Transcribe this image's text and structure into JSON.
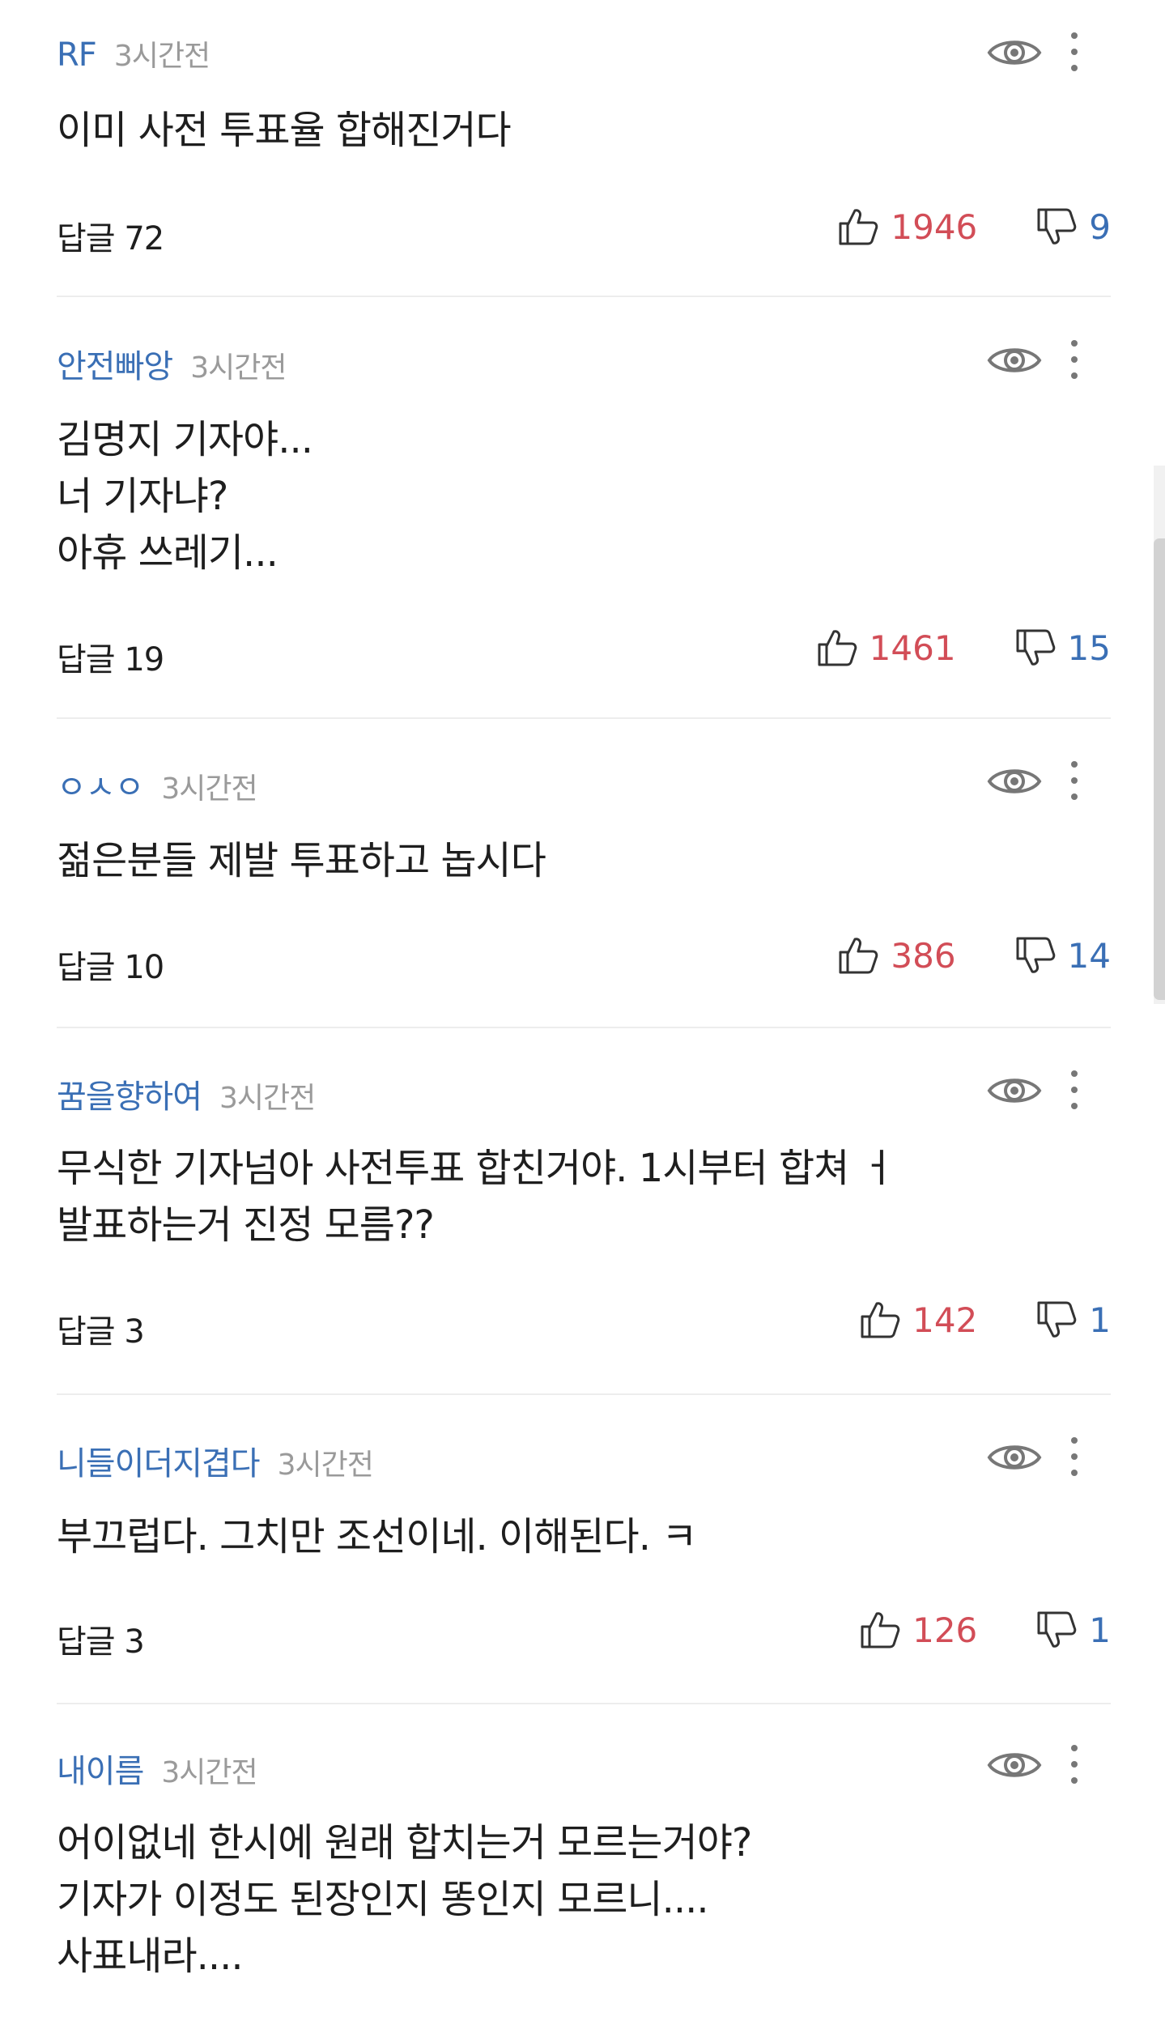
{
  "comments": [
    {
      "author": "RF",
      "time": "3시간전",
      "lines": [
        "이미 사전 투표율 합해진거다"
      ],
      "reply": "답글 72",
      "likes": "1946",
      "dislikes": "9"
    },
    {
      "author": "안전빠앙",
      "time": "3시간전",
      "lines": [
        "김명지 기자야...",
        "너 기자냐?",
        "아휴 쓰레기..."
      ],
      "reply": "답글 19",
      "likes": "1461",
      "dislikes": "15"
    },
    {
      "author": "ㅇㅅㅇ",
      "time": "3시간전",
      "lines": [
        "젊은분들 제발 투표하고 놉시다"
      ],
      "reply": "답글 10",
      "likes": "386",
      "dislikes": "14"
    },
    {
      "author": "꿈을향하여",
      "time": "3시간전",
      "lines": [
        "무식한 기자넘아 사전투표 합친거야. 1시부터 합쳐 ㅓ",
        "발표하는거 진정 모름??"
      ],
      "reply": "답글 3",
      "likes": "142",
      "dislikes": "1"
    },
    {
      "author": "니들이더지겹다",
      "time": "3시간전",
      "lines": [
        "부끄럽다.  그치만 조선이네.  이해된다. ㅋ"
      ],
      "reply": "답글 3",
      "likes": "126",
      "dislikes": "1"
    },
    {
      "author": "내이름",
      "time": "3시간전",
      "lines": [
        "어이없네 한시에 원래 합치는거 모르는거야?",
        "기자가 이정도 된장인지 똥인지 모르니....",
        "사표내라...."
      ],
      "reply": "",
      "likes": "",
      "dislikes": ""
    }
  ],
  "icons": {
    "view": "eye-icon",
    "menu": "more-vertical-icon",
    "like": "thumbs-up-icon",
    "dislike": "thumbs-down-icon"
  },
  "colors": {
    "author": "#3a6fb5",
    "like_count": "#d24d57",
    "dislike_count": "#3a6fb5",
    "time": "#9a9a9a",
    "icon": "#777777"
  }
}
